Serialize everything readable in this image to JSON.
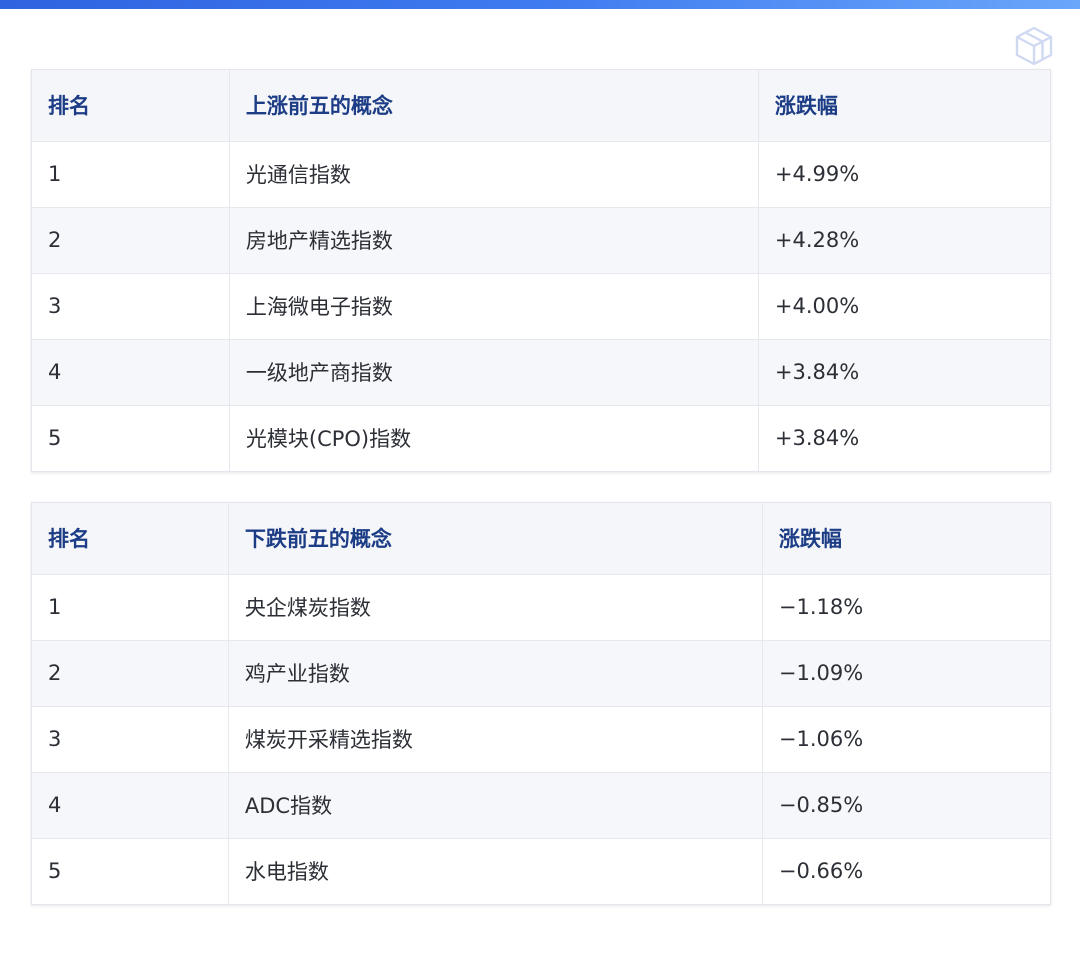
{
  "accent_color": "#2f63e0",
  "header_text_color": "#1c3d86",
  "logo_icon": "cube-logo-icon",
  "gainers": {
    "headers": [
      "排名",
      "上涨前五的概念",
      "涨跌幅"
    ],
    "rows": [
      {
        "rank": "1",
        "name": "光通信指数",
        "change": "+4.99%"
      },
      {
        "rank": "2",
        "name": "房地产精选指数",
        "change": "+4.28%"
      },
      {
        "rank": "3",
        "name": "上海微电子指数",
        "change": "+4.00%"
      },
      {
        "rank": "4",
        "name": "一级地产商指数",
        "change": "+3.84%"
      },
      {
        "rank": "5",
        "name": "光模块(CPO)指数",
        "change": "+3.84%"
      }
    ]
  },
  "losers": {
    "headers": [
      "排名",
      "下跌前五的概念",
      "涨跌幅"
    ],
    "rows": [
      {
        "rank": "1",
        "name": "央企煤炭指数",
        "change": "−1.18%"
      },
      {
        "rank": "2",
        "name": "鸡产业指数",
        "change": "−1.09%"
      },
      {
        "rank": "3",
        "name": "煤炭开采精选指数",
        "change": "−1.06%"
      },
      {
        "rank": "4",
        "name": "ADC指数",
        "change": "−0.85%"
      },
      {
        "rank": "5",
        "name": "水电指数",
        "change": "−0.66%"
      }
    ]
  }
}
